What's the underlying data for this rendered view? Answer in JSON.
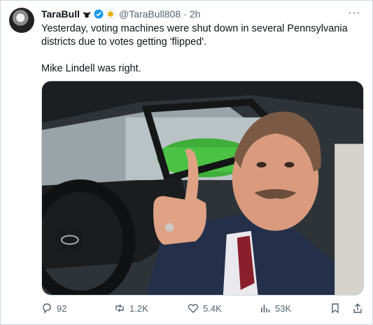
{
  "author": {
    "display_name": "TaraBull",
    "handle": "@TaraBull808",
    "time": "2h"
  },
  "tweet": {
    "text": "Yesterday, voting machines were shut down in several Pennsylvania districts due to votes getting 'flipped'.\n\nMike Lindell was right."
  },
  "colors": {
    "verified": "#1d9bf0",
    "muted_text": "#536471",
    "org_badge": "#e8b117"
  },
  "actions": {
    "replies": "92",
    "reposts": "1.2K",
    "likes": "5.4K",
    "views": "53K"
  }
}
